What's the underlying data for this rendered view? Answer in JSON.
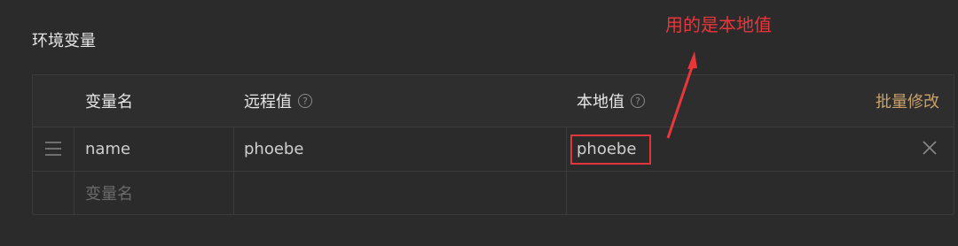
{
  "section": {
    "title": "环境变量"
  },
  "table": {
    "headers": {
      "name": "变量名",
      "remote": "远程值",
      "local": "本地值",
      "help_glyph": "?",
      "batch_edit": "批量修改"
    },
    "rows": [
      {
        "name": "name",
        "remote": "phoebe",
        "local": "phoebe"
      }
    ],
    "new_row": {
      "name_placeholder": "变量名"
    }
  },
  "annotation": {
    "text": "用的是本地值",
    "color": "#e8363b"
  },
  "colors": {
    "background": "#2b2b2b",
    "accent": "#c9a26a",
    "border": "#3c3c3c"
  },
  "icons": [
    "help-icon",
    "drag-handle-icon",
    "close-icon",
    "arrow-icon"
  ]
}
